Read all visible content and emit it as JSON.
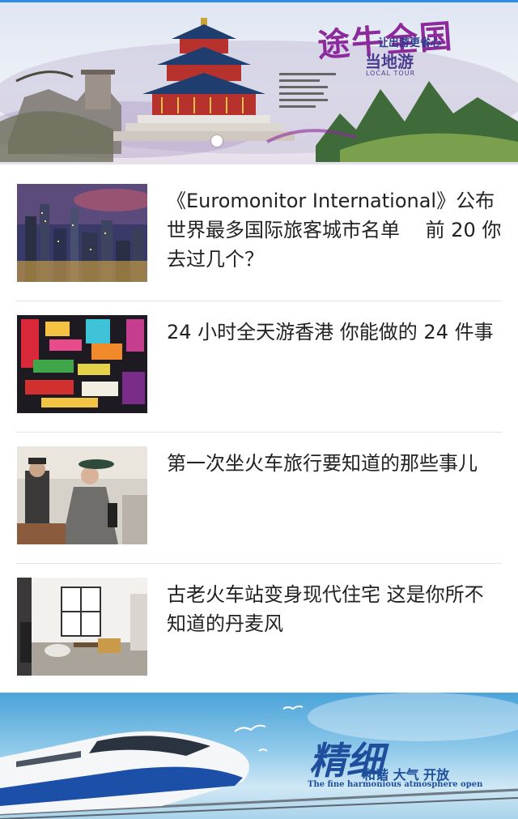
{
  "top_banner": {
    "title": "途牛全国",
    "subtitle": "让出游更省心",
    "local_tour": "当地游",
    "local_tour_en": "LOCAL TOUR"
  },
  "news": [
    {
      "title": "《Euromonitor International》公布世界最多国际旅客城市名单　 前 20 你去过几个？",
      "thumb_icon": "city-night-skyline-image"
    },
    {
      "title": "24 小时全天游香港 你能做的 24 件事",
      "thumb_icon": "hong-kong-neon-signs-image"
    },
    {
      "title": "第一次坐火车旅行要知道的那些事儿",
      "thumb_icon": "vintage-train-travelers-image"
    },
    {
      "title": "古老火车站变身现代住宅 这是你所不知道的丹麦风",
      "thumb_icon": "danish-interior-room-image"
    }
  ],
  "bottom_banner": {
    "headline": "精细",
    "slogan": "和谐 大气 开放",
    "slogan_en": "The fine harmonious atmosphere open"
  },
  "colors": {
    "accent_line": "#2f8ee0",
    "banner_title": "#8d2a9b",
    "bottom_text": "#1f4f9c"
  }
}
